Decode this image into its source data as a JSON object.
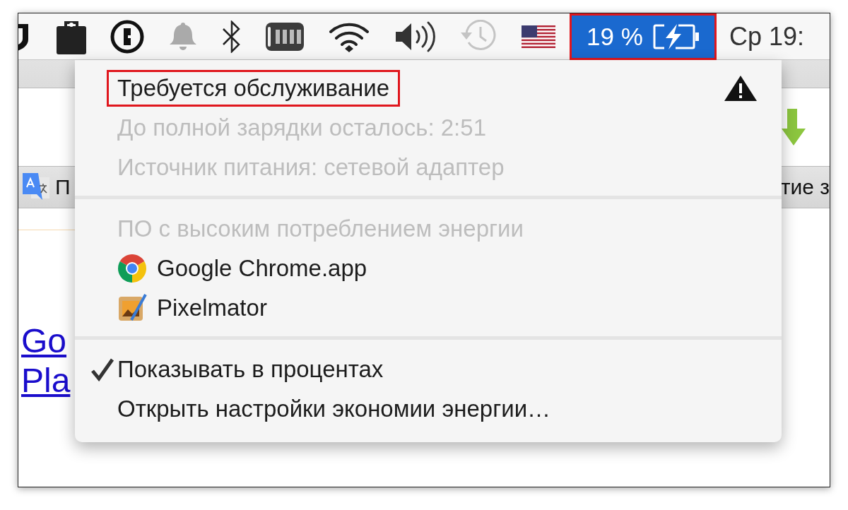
{
  "menu_bar": {
    "battery": {
      "percent": "19 %",
      "selected": true,
      "highlighted": true
    },
    "clock": "Ср 19:"
  },
  "browser": {
    "bookmark_bar": {
      "left_text": "П",
      "right_text": "тие з"
    },
    "links": [
      "Go",
      "Pla"
    ]
  },
  "menu": {
    "sections": [
      {
        "items": [
          {
            "kind": "status",
            "label": "Требуется обслуживание",
            "highlighted": true,
            "disabled": false
          },
          {
            "kind": "info",
            "label": "До полной зарядки осталось: 2:51",
            "disabled": true
          },
          {
            "kind": "info",
            "label": "Источник питания: сетевой адаптер",
            "disabled": true
          }
        ]
      },
      {
        "items": [
          {
            "kind": "heading",
            "label": "ПО с высоким потреблением энергии",
            "disabled": true
          },
          {
            "kind": "app",
            "label": "Google Chrome.app",
            "disabled": false
          },
          {
            "kind": "app",
            "label": "Pixelmator",
            "disabled": false
          }
        ]
      },
      {
        "items": [
          {
            "kind": "option",
            "label": "Показывать в процентах",
            "checked": true,
            "disabled": false
          },
          {
            "kind": "option",
            "label": "Открыть настройки экономии энергии…",
            "checked": false,
            "disabled": false
          }
        ]
      }
    ]
  }
}
